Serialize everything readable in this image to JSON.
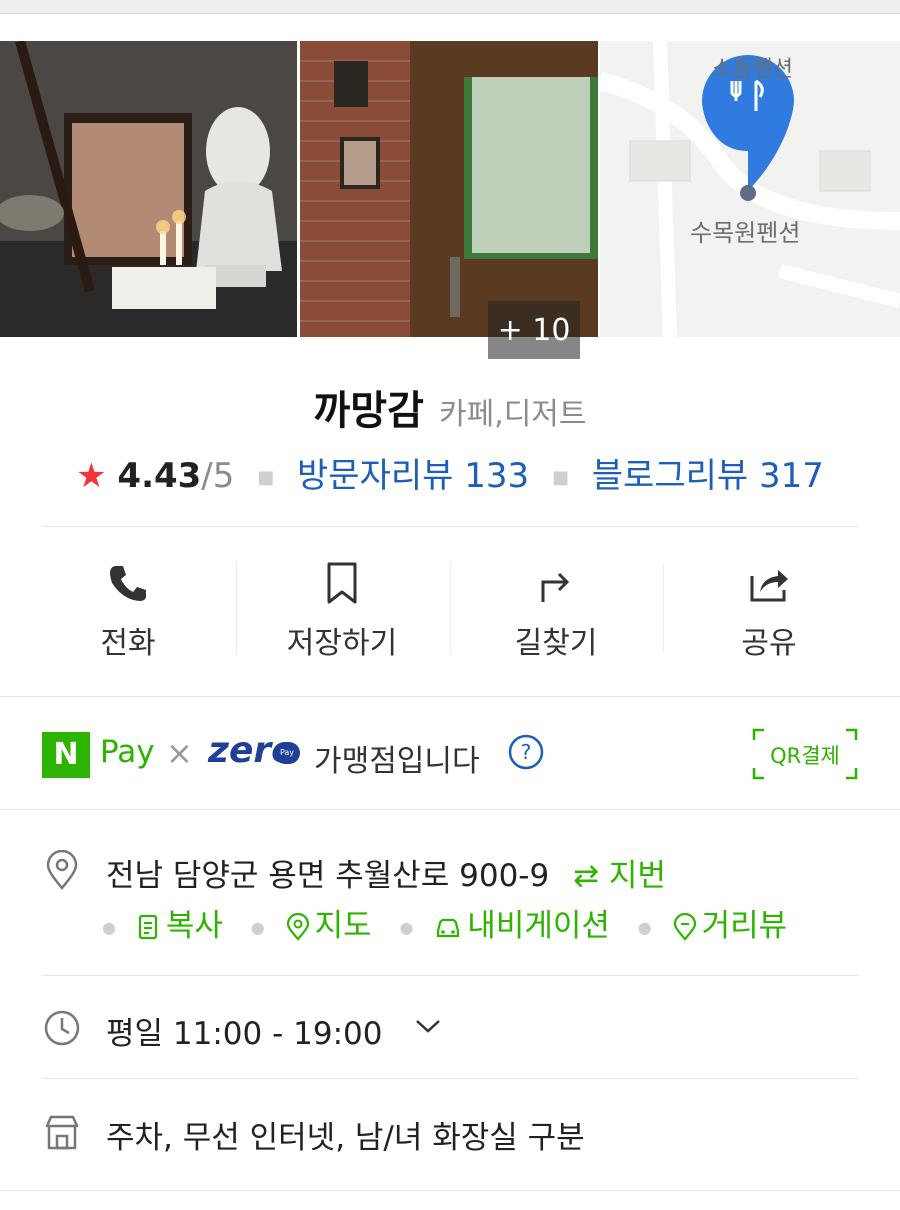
{
  "gallery": {
    "more_count": "+ 10",
    "map_labels": [
      "소듬펜션",
      "수목원펜션"
    ]
  },
  "place": {
    "name": "까망감",
    "category": "카페,디저트"
  },
  "rating": {
    "star": "★",
    "score": "4.43",
    "out_of": "/5",
    "visitor_reviews": "방문자리뷰 133",
    "blog_reviews": "블로그리뷰 317"
  },
  "actions": [
    {
      "label": "전화",
      "icon": "phone-icon"
    },
    {
      "label": "저장하기",
      "icon": "bookmark-icon"
    },
    {
      "label": "길찾기",
      "icon": "directions-icon"
    },
    {
      "label": "공유",
      "icon": "share-icon"
    }
  ],
  "pay": {
    "n": "N",
    "pay": "Pay",
    "times": "×",
    "zero": "zero",
    "zero_badge": "Pay",
    "merchant_text": "가맹점입니다",
    "qr_label": "QR결제"
  },
  "address": {
    "text": "전남 담양군 용면 추월산로 900-9",
    "lot_toggle": "⇄ 지번",
    "links": [
      "복사",
      "지도",
      "내비게이션",
      "거리뷰"
    ]
  },
  "hours": {
    "text": "평일 11:00 - 19:00",
    "expand": "⌄"
  },
  "amenities": {
    "text": "주차, 무선 인터넷, 남/녀 화장실 구분"
  },
  "colors": {
    "accent_green": "#2db400",
    "link_blue": "#1d5fb8",
    "star_red": "#f2353d",
    "zeropay_navy": "#1e3f9a"
  }
}
